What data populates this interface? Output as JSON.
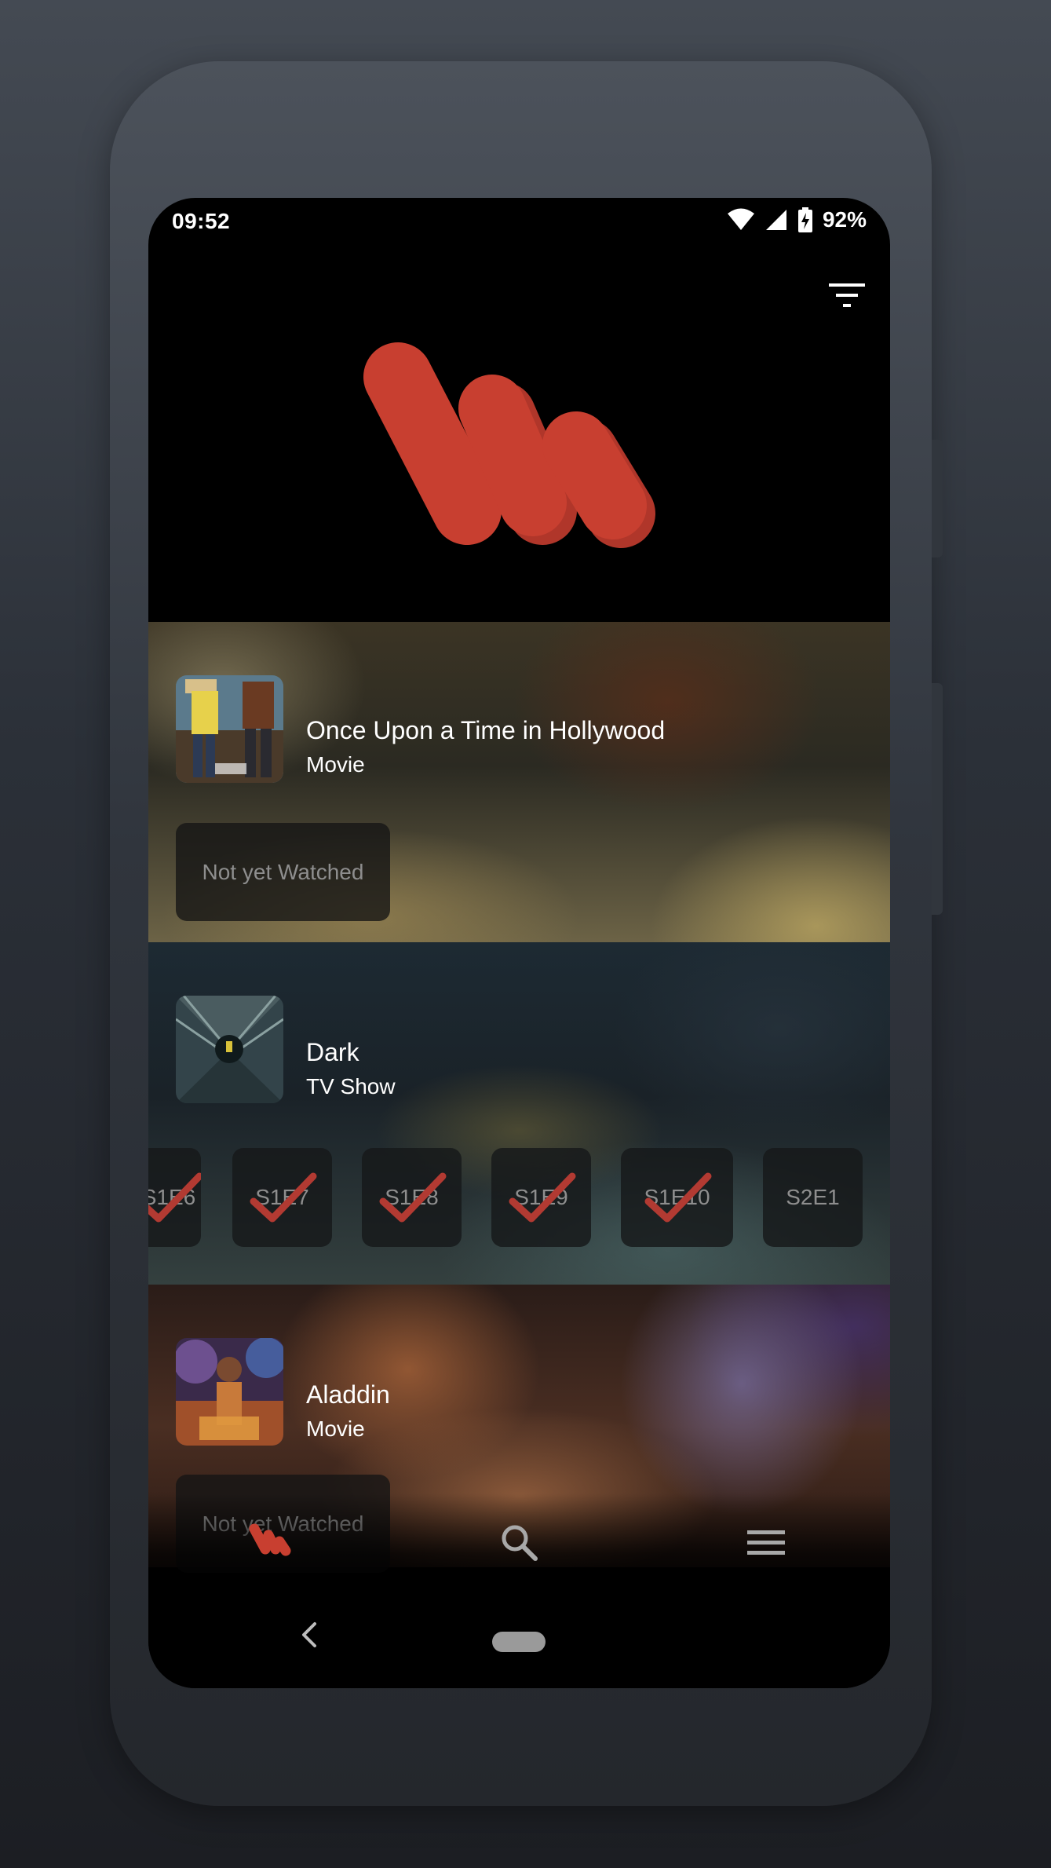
{
  "status_bar": {
    "time": "09:52",
    "battery": "92%"
  },
  "colors": {
    "brand": "#c83f30",
    "check": "#b23a32",
    "chip_text": "#8e8e8e"
  },
  "items": [
    {
      "title": "Once Upon a Time in Hollywood",
      "type": "Movie",
      "status": "Not yet Watched"
    },
    {
      "title": "Dark",
      "type": "TV Show",
      "episodes": [
        {
          "label": "S1E6",
          "watched": true
        },
        {
          "label": "S1E7",
          "watched": true
        },
        {
          "label": "S1E8",
          "watched": true
        },
        {
          "label": "S1E9",
          "watched": true
        },
        {
          "label": "S1E10",
          "watched": true
        },
        {
          "label": "S2E1",
          "watched": false
        }
      ]
    },
    {
      "title": "Aladdin",
      "type": "Movie",
      "status": "Not yet Watched"
    }
  ],
  "icons": {
    "filter": "filter-icon",
    "home": "watchlist-logo-icon",
    "search": "search-icon",
    "menu": "menu-icon",
    "back": "back-icon",
    "check": "check-icon"
  }
}
